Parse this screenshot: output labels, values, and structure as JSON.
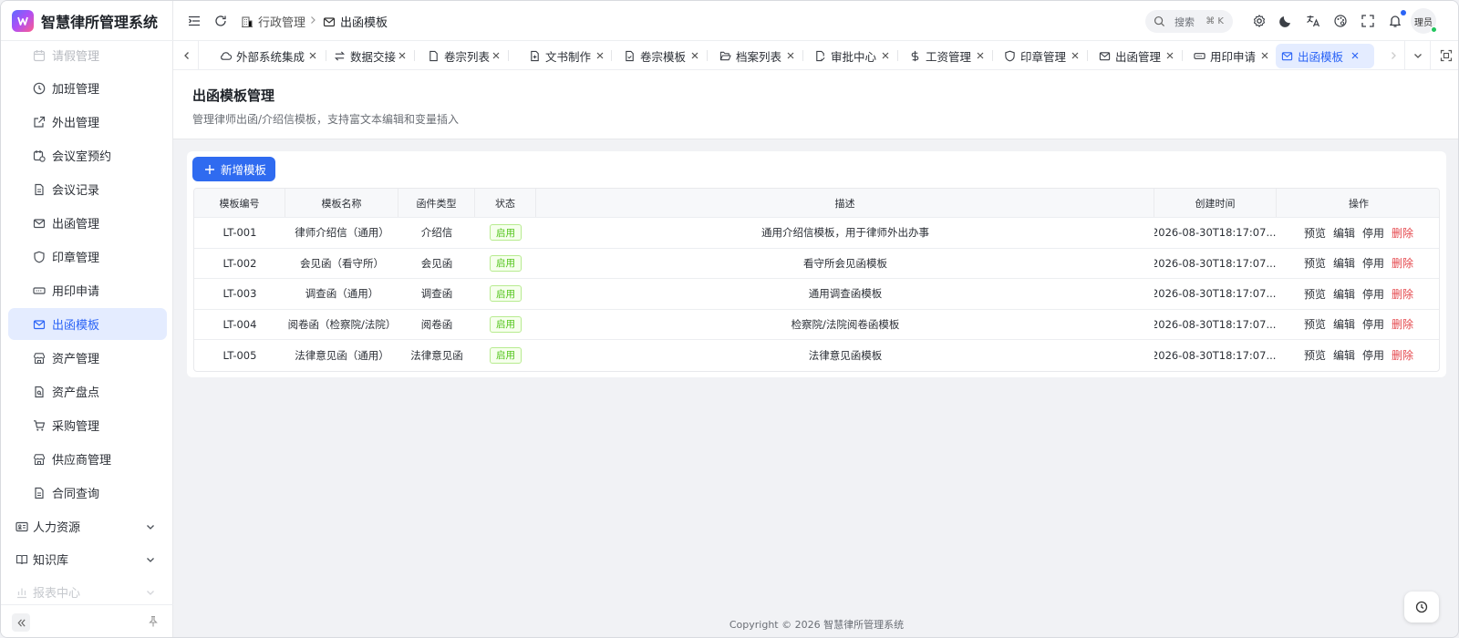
{
  "app": {
    "title": "智慧律所管理系统"
  },
  "sidebar": {
    "items": [
      {
        "label": "请假管理",
        "icon": "calendar-icon"
      },
      {
        "label": "加班管理",
        "icon": "clock-icon"
      },
      {
        "label": "外出管理",
        "icon": "external-link-icon"
      },
      {
        "label": "会议室预约",
        "icon": "calendar-clock-icon"
      },
      {
        "label": "会议记录",
        "icon": "document-icon"
      },
      {
        "label": "出函管理",
        "icon": "mail-icon"
      },
      {
        "label": "印章管理",
        "icon": "shield-icon"
      },
      {
        "label": "用印申请",
        "icon": "ticket-icon"
      },
      {
        "label": "出函模板",
        "icon": "mail-icon"
      },
      {
        "label": "资产管理",
        "icon": "store-icon"
      },
      {
        "label": "资产盘点",
        "icon": "file-search-icon"
      },
      {
        "label": "采购管理",
        "icon": "cart-icon"
      },
      {
        "label": "供应商管理",
        "icon": "store-icon"
      },
      {
        "label": "合同查询",
        "icon": "document-icon"
      }
    ],
    "active_index": 8,
    "groups": [
      {
        "label": "人力资源",
        "icon": "id-card-icon"
      },
      {
        "label": "知识库",
        "icon": "book-icon"
      },
      {
        "label": "报表中心",
        "icon": "bar-chart-icon"
      }
    ]
  },
  "header": {
    "breadcrumb": [
      {
        "label": "行政管理",
        "icon": "building-icon"
      },
      {
        "label": "出函模板",
        "icon": "mail-icon"
      }
    ],
    "search": {
      "label": "搜索",
      "shortcut": "⌘ K"
    },
    "user": {
      "avatar_text": "理员"
    }
  },
  "tabs": [
    {
      "label": "外部系统集成",
      "icon": "cloud-icon"
    },
    {
      "label": "数据交接",
      "icon": "arrows-exchange-icon"
    },
    {
      "label": "卷宗列表",
      "icon": "file-icon"
    },
    {
      "label": "文书制作",
      "icon": "file-plus-icon"
    },
    {
      "label": "卷宗模板",
      "icon": "file-check-icon"
    },
    {
      "label": "档案列表",
      "icon": "folder-open-icon"
    },
    {
      "label": "审批中心",
      "icon": "file-approve-icon"
    },
    {
      "label": "工资管理",
      "icon": "dollar-icon"
    },
    {
      "label": "印章管理",
      "icon": "shield-icon"
    },
    {
      "label": "出函管理",
      "icon": "mail-icon"
    },
    {
      "label": "用印申请",
      "icon": "ticket-icon"
    },
    {
      "label": "出函模板",
      "icon": "mail-icon"
    }
  ],
  "active_tab": 11,
  "page": {
    "title": "出函模板管理",
    "description": "管理律师出函/介绍信模板，支持富文本编辑和变量插入",
    "add_button": "新增模板"
  },
  "table": {
    "columns": [
      "模板编号",
      "模板名称",
      "函件类型",
      "状态",
      "描述",
      "创建时间",
      "操作"
    ],
    "rows": [
      {
        "code": "LT-001",
        "name": "律师介绍信（通用）",
        "type": "介绍信",
        "status": "启用",
        "desc": "通用介绍信模板，用于律师外出办事",
        "created": "2026-08-30T18:17:07...."
      },
      {
        "code": "LT-002",
        "name": "会见函（看守所）",
        "type": "会见函",
        "status": "启用",
        "desc": "看守所会见函模板",
        "created": "2026-08-30T18:17:07...."
      },
      {
        "code": "LT-003",
        "name": "调查函（通用）",
        "type": "调查函",
        "status": "启用",
        "desc": "通用调查函模板",
        "created": "2026-08-30T18:17:07...."
      },
      {
        "code": "LT-004",
        "name": "阅卷函（检察院/法院）",
        "type": "阅卷函",
        "status": "启用",
        "desc": "检察院/法院阅卷函模板",
        "created": "2026-08-30T18:17:07...."
      },
      {
        "code": "LT-005",
        "name": "法律意见函（通用）",
        "type": "法律意见函",
        "status": "启用",
        "desc": "法律意见函模板",
        "created": "2026-08-30T18:17:07...."
      }
    ],
    "actions": {
      "preview": "预览",
      "edit": "编辑",
      "disable": "停用",
      "delete": "删除"
    }
  },
  "footer": {
    "copyright": "Copyright © 2026  智慧律所管理系统"
  },
  "colors": {
    "primary": "#2f6bf0",
    "active_bg": "#e4ecff",
    "danger": "#e5484d",
    "success": "#52c41a"
  }
}
